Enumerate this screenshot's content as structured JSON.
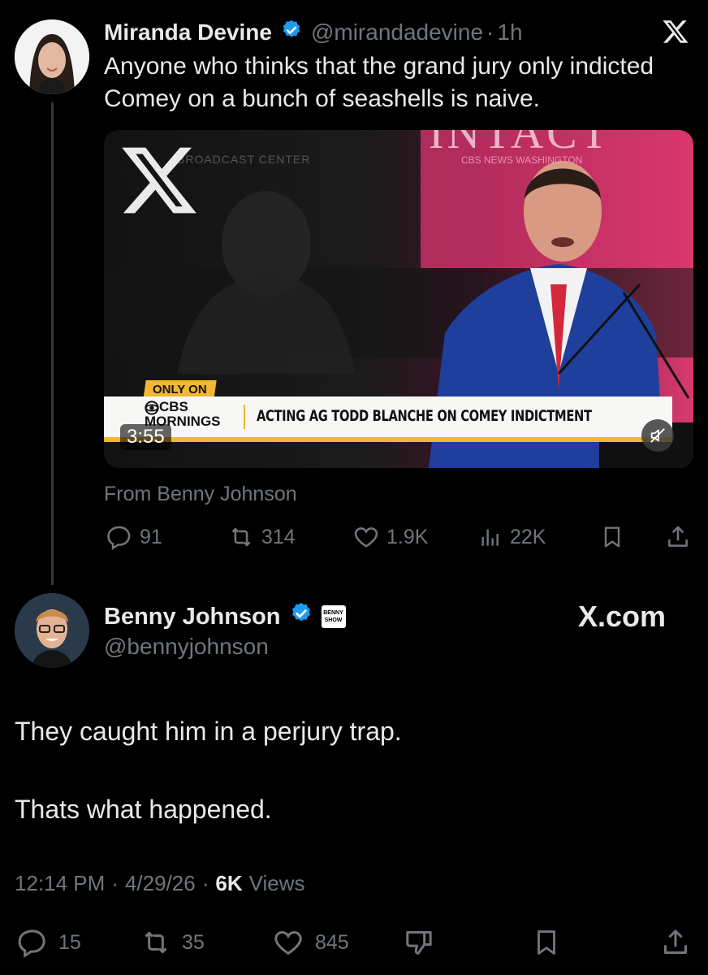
{
  "parent_tweet": {
    "author_name": "Miranda Devine",
    "handle": "@mirandadevine",
    "separator": "·",
    "time": "1h",
    "text_line1": "Anyone who thinks that the grand jury only indicted",
    "text_line2": "Comey on a bunch of seashells is naive.",
    "media": {
      "watermark_text": "BROADCAST CENTER",
      "banner_tag": "ONLY ON",
      "network_top": "CBS",
      "network_bottom": "MORNINGS",
      "headline": "ACTING AG TODD BLANCHE ON COMEY INDICTMENT",
      "duration": "3:55",
      "stage_text": "INTACT",
      "location_text": "CBS NEWS WASHINGTON"
    },
    "from_text": "From Benny Johnson",
    "stats": {
      "replies": "91",
      "reposts": "314",
      "likes": "1.9K",
      "views": "22K"
    }
  },
  "main_tweet": {
    "author_name": "Benny Johnson",
    "handle": "@bennyjohnson",
    "affiliate_badge_line1": "BENNY",
    "affiliate_badge_line2": "SHOW",
    "site_label": "X.com",
    "text_line1": "They caught him in a perjury trap.",
    "text_line2": "Thats what happened.",
    "time": "12:14 PM",
    "date": "4/29/26",
    "separator": "·",
    "views_count": "6K",
    "views_label": "Views",
    "stats": {
      "replies": "15",
      "reposts": "35",
      "likes": "845"
    }
  },
  "colors": {
    "background": "#000000",
    "text": "#e7e9ea",
    "muted": "#71767b",
    "verified": "#1d9bf0",
    "banner_yellow": "#f2b632",
    "stage_pink": "#d93a6e"
  }
}
